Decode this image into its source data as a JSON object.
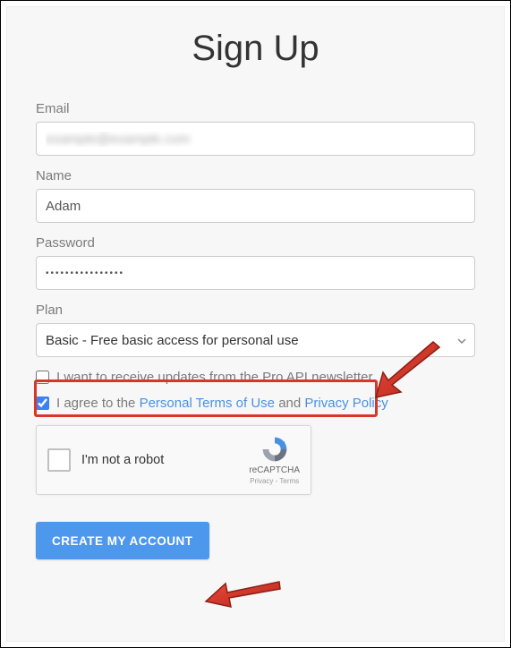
{
  "title": "Sign Up",
  "email": {
    "label": "Email",
    "value": "example@example.com"
  },
  "name": {
    "label": "Name",
    "value": "Adam"
  },
  "password": {
    "label": "Password",
    "value": "••••••••••••••••"
  },
  "plan": {
    "label": "Plan",
    "selected": "Basic - Free basic access for personal use"
  },
  "newsletter": {
    "label": "I want to receive updates from the Pro API newsletter",
    "checked": false
  },
  "terms": {
    "prefix": "I agree to the ",
    "link1": "Personal Terms of Use",
    "middle": " and ",
    "link2": "Privacy Policy",
    "checked": true
  },
  "recaptcha": {
    "label": "I'm not a robot",
    "brand": "reCAPTCHA",
    "footer": "Privacy - Terms"
  },
  "submit": {
    "label": "CREATE MY ACCOUNT"
  }
}
